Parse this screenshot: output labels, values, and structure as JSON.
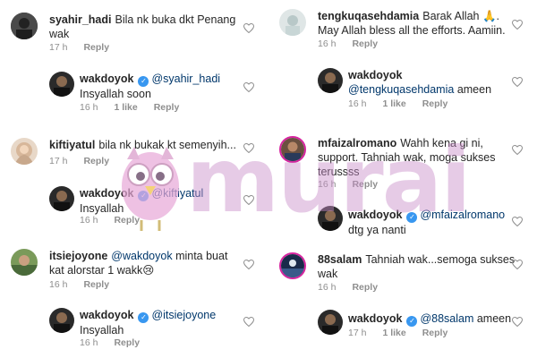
{
  "colors": {
    "username": "#262626",
    "mention": "#00376b",
    "meta": "#8e8e8e",
    "verified": "#3897f0",
    "watermark": "#c88cc8"
  },
  "watermark_text": "murai",
  "left_column": [
    {
      "username": "syahir_hadi",
      "text": "Bila nk buka dkt Penang wak",
      "time": "17 h",
      "likes": "",
      "reply": "Reply",
      "avatar": "avatar-dark",
      "reply_thread": {
        "username": "wakdoyok",
        "verified": true,
        "mention": "@syahir_hadi",
        "text": "Insyallah soon",
        "time": "16 h",
        "likes": "1 like",
        "reply": "Reply"
      }
    },
    {
      "username": "kiftiyatul",
      "text": "bila nk bukak kt semenyih...",
      "time": "17 h",
      "likes": "",
      "reply": "Reply",
      "avatar": "avatar-hijab",
      "reply_thread": {
        "username": "wakdoyok",
        "verified": true,
        "mention": "@kiftiyatul",
        "text": "Insyallah",
        "time": "16 h",
        "likes": "",
        "reply": "Reply"
      }
    },
    {
      "username": "itsiejoyone",
      "text": "minta buat kat alorstar 1 wakk😢",
      "mention": "@wakdoyok",
      "time": "16 h",
      "likes": "",
      "reply": "Reply",
      "avatar": "avatar-outdoor",
      "reply_thread": {
        "username": "wakdoyok",
        "verified": true,
        "mention": "@itsiejoyone",
        "text": "Insyallah",
        "time": "16 h",
        "likes": "",
        "reply": "Reply"
      }
    }
  ],
  "right_column": [
    {
      "username": "tengkuqasehdamia",
      "text": "Barak Allah 🙏. May Allah bless all the efforts. Aamiin.",
      "time": "16 h",
      "likes": "",
      "reply": "Reply",
      "avatar": "avatar-light",
      "reply_thread": {
        "username": "wakdoyok",
        "verified": false,
        "mention": "@tengkuqasehdamia",
        "text": "ameen",
        "time": "16 h",
        "likes": "1 like",
        "reply": "Reply"
      }
    },
    {
      "username": "mfaizalromano",
      "text": "Wahh kena gi ni, support. Tahniah wak, moga sukses terussss",
      "time": "16 h",
      "likes": "",
      "reply": "Reply",
      "avatar": "avatar-man",
      "reply_thread": {
        "username": "wakdoyok",
        "verified": true,
        "mention": "@mfaizalromano",
        "text": "dtg ya nanti",
        "time": "16 h",
        "likes": "",
        "reply": "Reply"
      }
    },
    {
      "username": "88salam",
      "text": "Tahniah wak...semoga sukses wak",
      "time": "16 h",
      "likes": "",
      "reply": "Reply",
      "avatar": "avatar-stage",
      "reply_thread": {
        "username": "wakdoyok",
        "verified": true,
        "mention": "@88salam",
        "text": "ameen",
        "time": "17 h",
        "likes": "1 like",
        "reply": "Reply"
      }
    }
  ]
}
